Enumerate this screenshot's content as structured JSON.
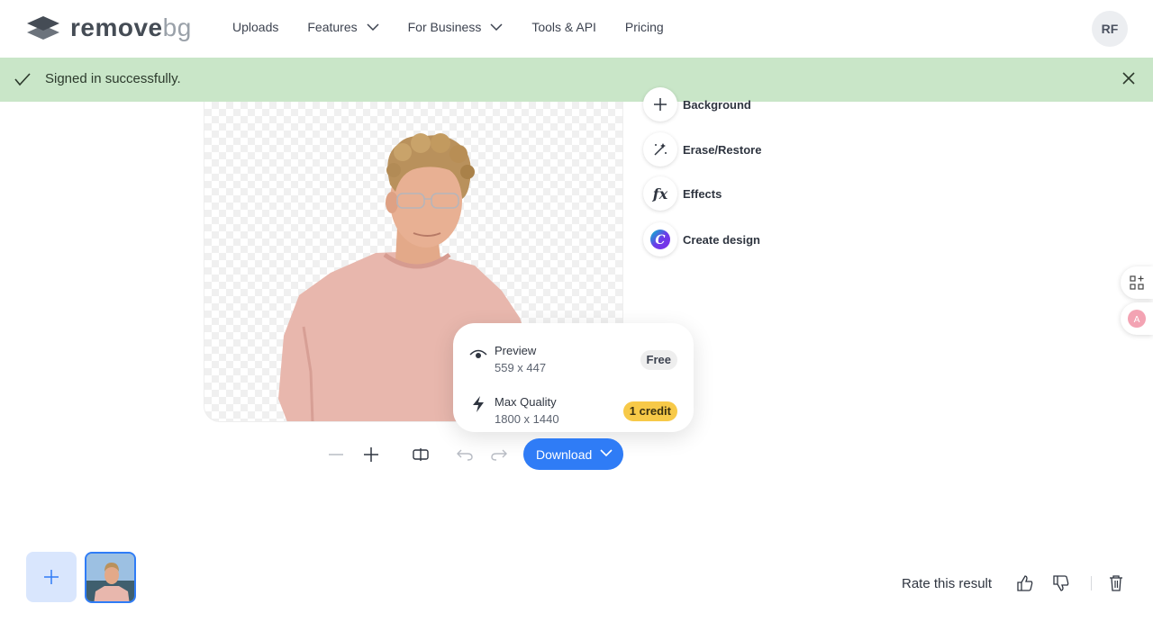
{
  "brand": {
    "name_main": "remove",
    "name_suffix": "bg"
  },
  "nav": {
    "items": [
      {
        "label": "Uploads"
      },
      {
        "label": "Features"
      },
      {
        "label": "For Business"
      },
      {
        "label": "Tools & API"
      },
      {
        "label": "Pricing"
      }
    ]
  },
  "user": {
    "initials": "RF"
  },
  "toast": {
    "message": "Signed in successfully."
  },
  "tools": [
    {
      "label": "Background",
      "icon": "plus-icon"
    },
    {
      "label": "Erase/Restore",
      "icon": "magic-wand-icon"
    },
    {
      "label": "Effects",
      "icon": "fx-icon"
    },
    {
      "label": "Create design",
      "icon": "canva-icon"
    }
  ],
  "download_menu": {
    "preview": {
      "title": "Preview",
      "size": "559 x 447",
      "badge": "Free"
    },
    "max_quality": {
      "title": "Max Quality",
      "size": "1800 x 1440",
      "badge": "1 credit"
    }
  },
  "download_label": "Download",
  "rating": {
    "label": "Rate this result"
  },
  "colors": {
    "accent": "#2f7cf6",
    "toast_bg": "#c9e6c8",
    "credit_badge": "#f7c948"
  }
}
